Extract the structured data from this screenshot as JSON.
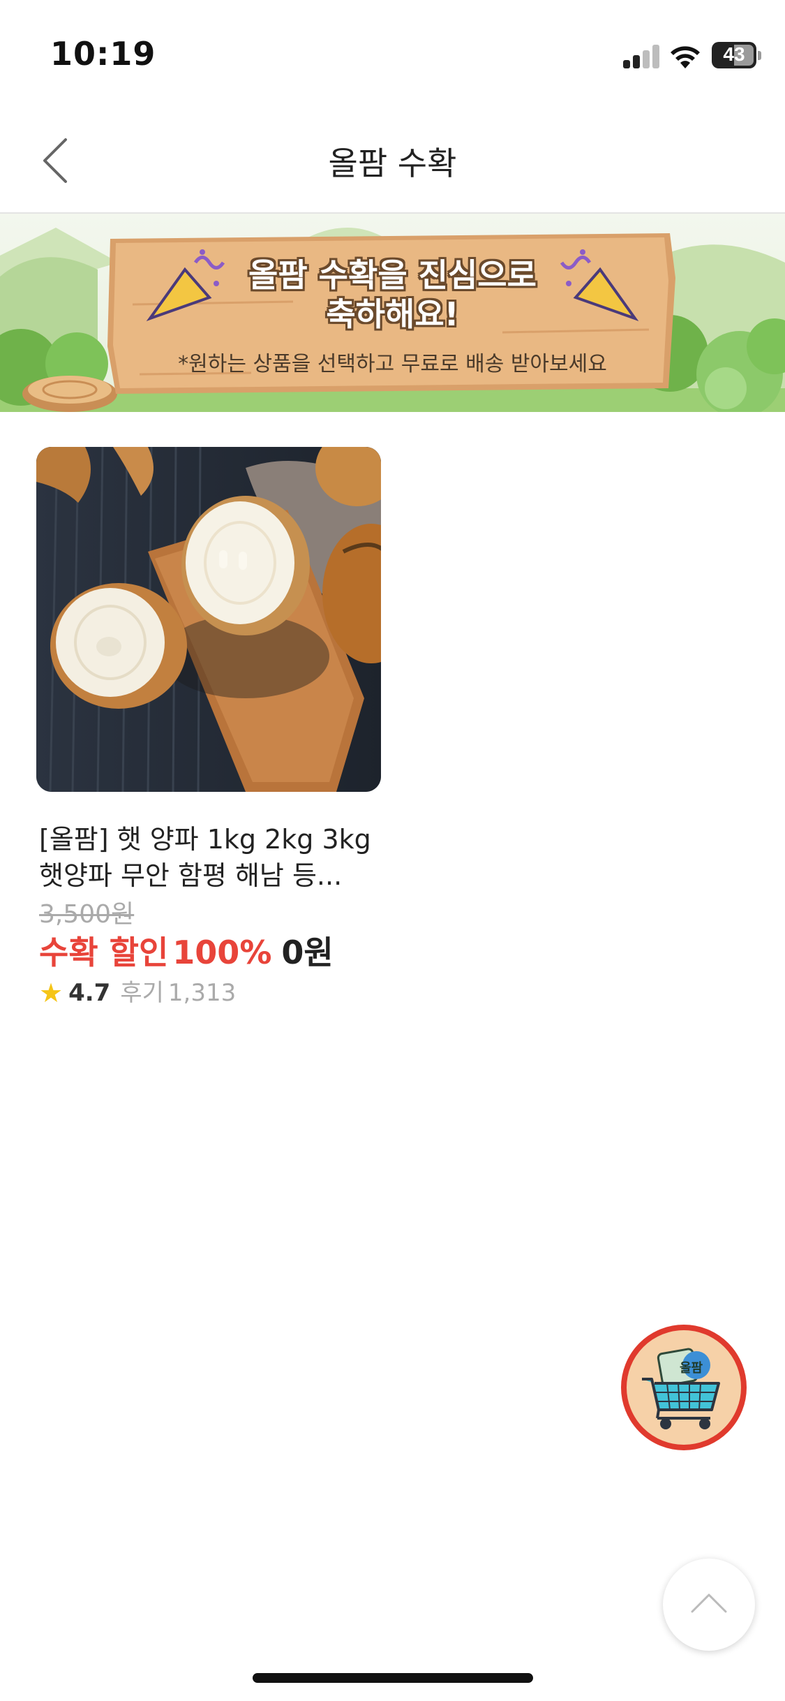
{
  "status_bar": {
    "time": "10:19",
    "battery": "43"
  },
  "nav": {
    "title": "올팜 수확"
  },
  "banner": {
    "title_line1": "올팜 수확을 진심으로",
    "title_line2": "축하해요!",
    "subtitle": "*원하는 상품을 선택하고 무료로 배송 받아보세요"
  },
  "product": {
    "name_line1": "[올팜] 햇 양파 1kg 2kg 3kg",
    "name_line2": "햇양파 무안 함평 해남 등...",
    "original_price": "3,500원",
    "discount_label": "수확 할인",
    "discount_rate": "100%",
    "final_price": "0원",
    "rating": "4.7",
    "review_label": "후기",
    "review_count": "1,313"
  },
  "cart_fab": {
    "badge": "올팜"
  },
  "colors": {
    "accent_red": "#e8443a",
    "star": "#f5c518",
    "cart_border": "#e03a2d"
  }
}
